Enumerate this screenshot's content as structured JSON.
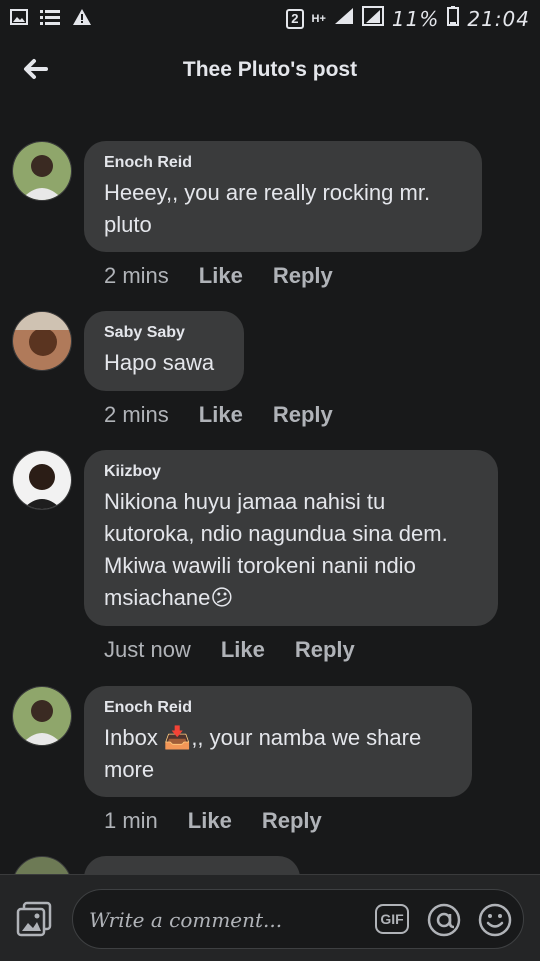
{
  "status_bar": {
    "sim_slot": "2",
    "network": "H+",
    "battery": "11%",
    "time": "21:04"
  },
  "header": {
    "title": "Thee Pluto's post"
  },
  "comments": [
    {
      "author": "Enoch Reid",
      "text": "Heeey,, you are really rocking  mr. pluto",
      "time": "2 mins",
      "like": "Like",
      "reply": "Reply"
    },
    {
      "author": "Saby Saby",
      "text": "Hapo sawa",
      "time": "2 mins",
      "like": "Like",
      "reply": "Reply"
    },
    {
      "author": "Kiizboy",
      "text": "Nikiona huyu jamaa nahisi tu kutoroka, ndio nagundua sina dem. Mkiwa wawili torokeni nanii ndio msiachane😕",
      "time": "Just now",
      "like": "Like",
      "reply": "Reply"
    },
    {
      "author": "Enoch Reid",
      "text": "Inbox 📥,, your namba  we share more",
      "time": "1 min",
      "like": "Like",
      "reply": "Reply"
    }
  ],
  "composer": {
    "placeholder": "Write a comment...",
    "gif_label": "GIF"
  },
  "icons": {
    "back": "left-arrow-icon",
    "photo": "photo-icon",
    "gif": "gif-icon",
    "mention": "at-sign-icon",
    "emoji": "smiley-icon"
  },
  "colors": {
    "background": "#18191a",
    "bubble": "#3a3b3c",
    "text": "#e4e6eb",
    "muted": "#b0b3b8"
  }
}
